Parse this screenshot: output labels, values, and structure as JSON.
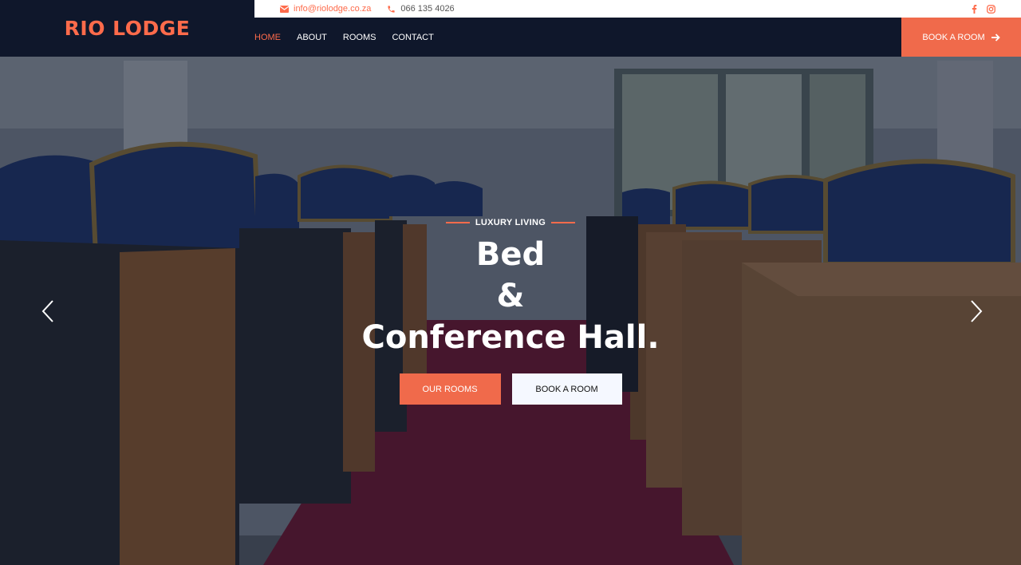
{
  "brand": {
    "name": "RIO LODGE",
    "accent": "#fe6b4b",
    "dark": "#0f172b"
  },
  "topbar": {
    "email": "info@riolodge.co.za",
    "phone": "066 135 4026",
    "social": [
      "facebook-icon",
      "instagram-icon"
    ]
  },
  "nav": {
    "items": [
      {
        "label": "HOME",
        "active": true
      },
      {
        "label": "ABOUT"
      },
      {
        "label": "ROOMS"
      },
      {
        "label": "CONTACT"
      }
    ],
    "cta": "BOOK A ROOM"
  },
  "hero": {
    "kicker": "LUXURY LIVING",
    "title_lines": [
      "Bed",
      "&",
      "Conference Hall."
    ],
    "primary_button": "OUR ROOMS",
    "secondary_button": "BOOK A ROOM"
  }
}
